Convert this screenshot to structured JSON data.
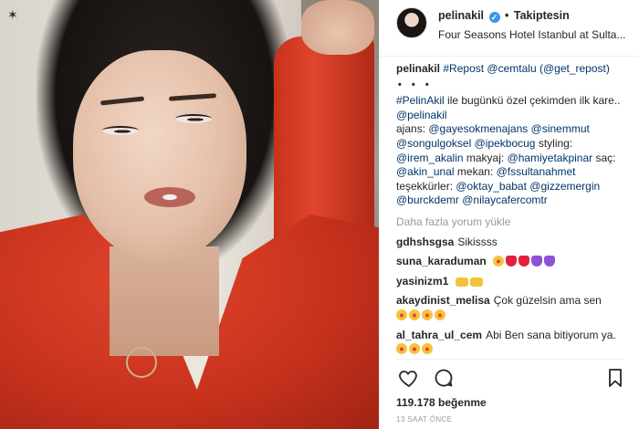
{
  "header": {
    "username": "pelinakil",
    "verified_icon": "check",
    "separator": "•",
    "follow_label": "Takiptesin",
    "location": "Four Seasons Hotel Istanbul at Sulta..."
  },
  "caption": {
    "username": "pelinakil",
    "repost_tag": "#Repost",
    "repost_user": "@cemtalu",
    "via": "(@get_repost)",
    "dots": "• • •",
    "hashtag": "#PelinAkil",
    "line1": "ile bugünkü özel çekimden ilk kare..",
    "mention1": "@pelinakil",
    "ajans_label": "ajans:",
    "m_ajans1": "@gayesokmenajans",
    "m_ajans2": "@sinemmut",
    "m_ajans3": "@songulgoksel",
    "m_ajans4": "@ipekbocug",
    "styling_label": "styling:",
    "m_styling": "@irem_akalin",
    "makyaj_label": "makyaj:",
    "m_makyaj": "@hamiyetakpinar",
    "sac_label": "saç:",
    "m_sac": "@akin_unal",
    "mekan_label": "mekan:",
    "m_mekan": "@fssultanahmet",
    "thanks_label": "teşekkürler:",
    "m_t1": "@oktay_babat",
    "m_t2": "@gizzemergin",
    "m_t3": "@burckdemr",
    "m_t4": "@nilaycafercomtr"
  },
  "load_more": "Daha fazla yorum yükle",
  "comments": [
    {
      "user": "gdhshsgsa",
      "text": "Sikissss"
    },
    {
      "user": "suna_karaduman",
      "text": ""
    },
    {
      "user": "yasinizm1",
      "text": ""
    },
    {
      "user": "akaydinist_melisa",
      "text": "Çok güzelsin ama sen"
    },
    {
      "user": "al_tahra_ul_cem",
      "text": "Abi Ben sana bitiyorum ya."
    }
  ],
  "icons": {
    "like": "heart-outline-icon",
    "comment": "comment-bubble-icon",
    "save": "bookmark-icon"
  },
  "likes_text": "119.178 beğenme",
  "time_text": "13 SAAT ÖNCE"
}
